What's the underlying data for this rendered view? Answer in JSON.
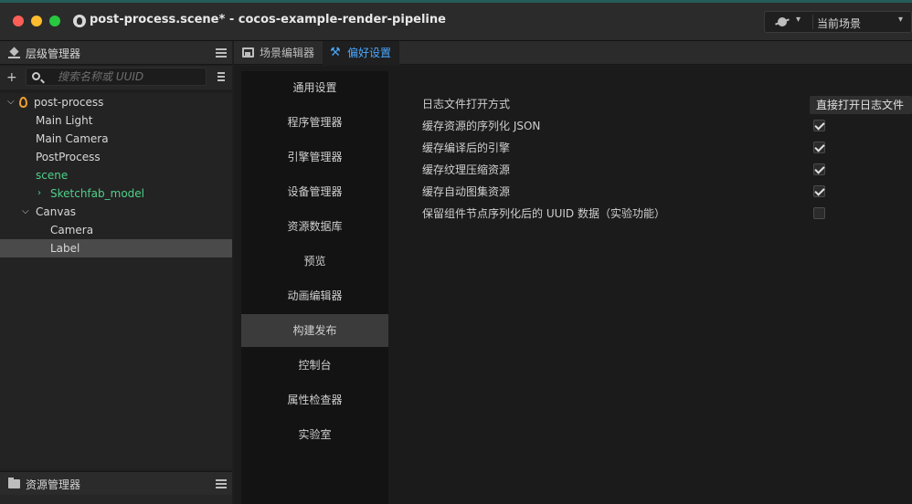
{
  "window": {
    "title": "post-process.scene* - cocos-example-render-pipeline",
    "scene_select": "当前场景"
  },
  "hierarchy": {
    "title": "层级管理器",
    "search_placeholder": "搜索名称或 UUID",
    "nodes": [
      {
        "label": "post-process",
        "expanded": true
      },
      {
        "label": "Main Light"
      },
      {
        "label": "Main Camera"
      },
      {
        "label": "PostProcess"
      },
      {
        "label": "scene",
        "color": "#4fd08a"
      },
      {
        "label": "Sketchfab_model",
        "color": "#4fd08a",
        "collapsed": true
      },
      {
        "label": "Canvas",
        "expanded": true
      },
      {
        "label": "Camera"
      },
      {
        "label": "Label",
        "selected": true
      }
    ]
  },
  "assets": {
    "title": "资源管理器"
  },
  "tabs": [
    {
      "label": "场景编辑器",
      "active": false
    },
    {
      "label": "偏好设置",
      "active": true
    }
  ],
  "prefs": {
    "nav": [
      {
        "label": "通用设置"
      },
      {
        "label": "程序管理器"
      },
      {
        "label": "引擎管理器"
      },
      {
        "label": "设备管理器"
      },
      {
        "label": "资源数据库"
      },
      {
        "label": "预览"
      },
      {
        "label": "动画编辑器"
      },
      {
        "label": "构建发布",
        "active": true
      },
      {
        "label": "控制台"
      },
      {
        "label": "属性检查器"
      },
      {
        "label": "实验室"
      }
    ],
    "settings": {
      "log_file": {
        "label": "日志文件打开方式",
        "button": "直接打开日志文件"
      },
      "checks": [
        {
          "label": "缓存资源的序列化 JSON",
          "checked": true
        },
        {
          "label": "缓存编译后的引擎",
          "checked": true
        },
        {
          "label": "缓存纹理压缩资源",
          "checked": true
        },
        {
          "label": "缓存自动图集资源",
          "checked": true
        },
        {
          "label": "保留组件节点序列化后的 UUID 数据（实验功能）",
          "checked": false
        }
      ]
    }
  },
  "colors": {
    "accent": "#49a7ff",
    "scene_node": "#4fd08a",
    "selected_row": "#4a4a4a"
  }
}
